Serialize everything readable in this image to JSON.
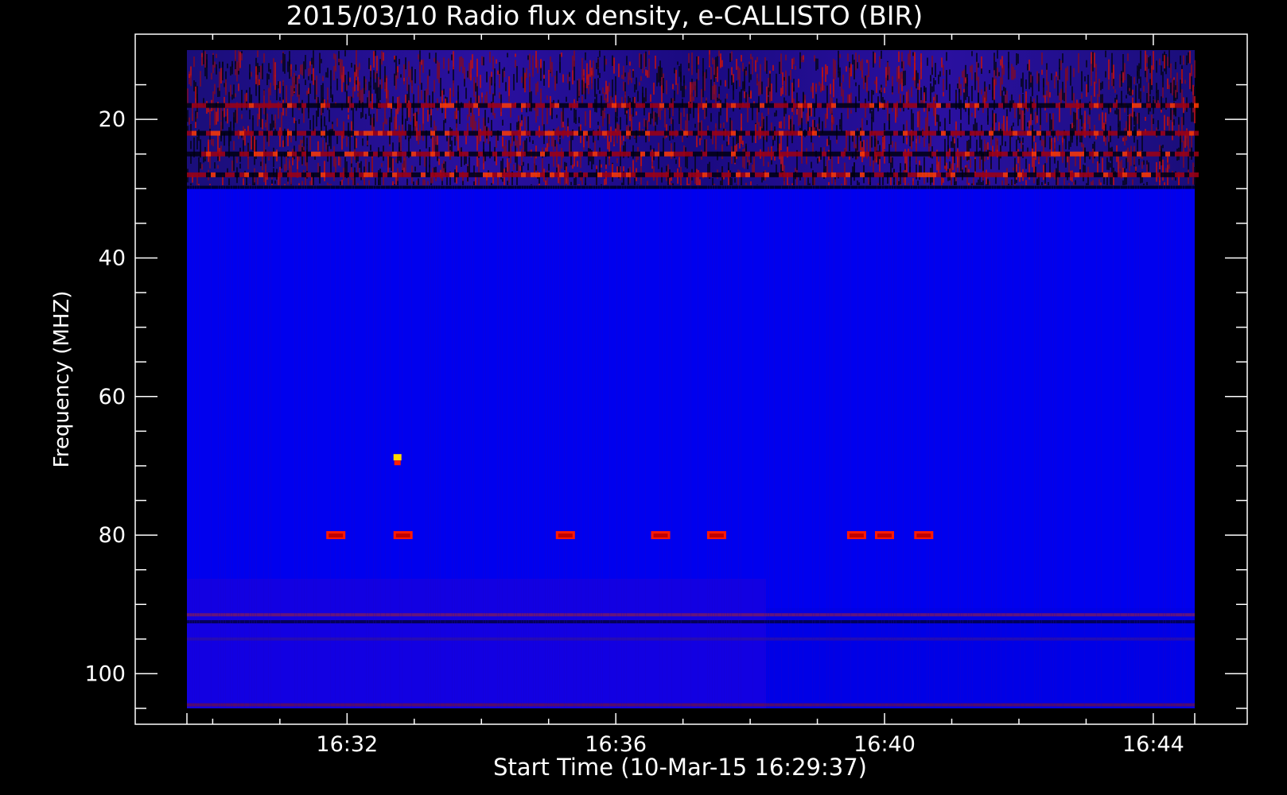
{
  "chart_data": {
    "type": "heatmap",
    "title": "2015/03/10  Radio flux density, e-CALLISTO (BIR)",
    "xlabel": "Start Time (10-Mar-15 16:29:37)",
    "ylabel": "Frequency (MHZ)",
    "x_range": [
      "16:29:37",
      "16:44:37"
    ],
    "y_range_mhz": [
      10,
      105
    ],
    "y_inverted": true,
    "x_ticks": [
      "16:32",
      "16:36",
      "16:40",
      "16:44"
    ],
    "x_tick_minutes": [
      32,
      36,
      40,
      44
    ],
    "y_ticks": [
      20,
      40,
      60,
      80,
      100
    ],
    "colormap": {
      "background": "#0000ff",
      "low": "#000010",
      "mid": "#8a0000",
      "high": "#ff2a00",
      "peak": "#ffd700"
    },
    "bands": [
      {
        "freq_mhz": 18,
        "note": "interference"
      },
      {
        "freq_mhz": 22,
        "note": "interference"
      },
      {
        "freq_mhz": 25,
        "note": "interference"
      },
      {
        "freq_mhz": 28,
        "note": "interference"
      }
    ],
    "bursts_80mhz": [
      {
        "time": "16:31:50",
        "freq_mhz": 80
      },
      {
        "time": "16:32:50",
        "freq_mhz": 80
      },
      {
        "time": "16:35:15",
        "freq_mhz": 80
      },
      {
        "time": "16:36:40",
        "freq_mhz": 80
      },
      {
        "time": "16:37:30",
        "freq_mhz": 80
      },
      {
        "time": "16:39:35",
        "freq_mhz": 80
      },
      {
        "time": "16:40:00",
        "freq_mhz": 80
      },
      {
        "time": "16:40:35",
        "freq_mhz": 80
      }
    ],
    "bursts_69mhz": [
      {
        "time": "16:32:45",
        "freq_mhz": 69
      }
    ]
  }
}
